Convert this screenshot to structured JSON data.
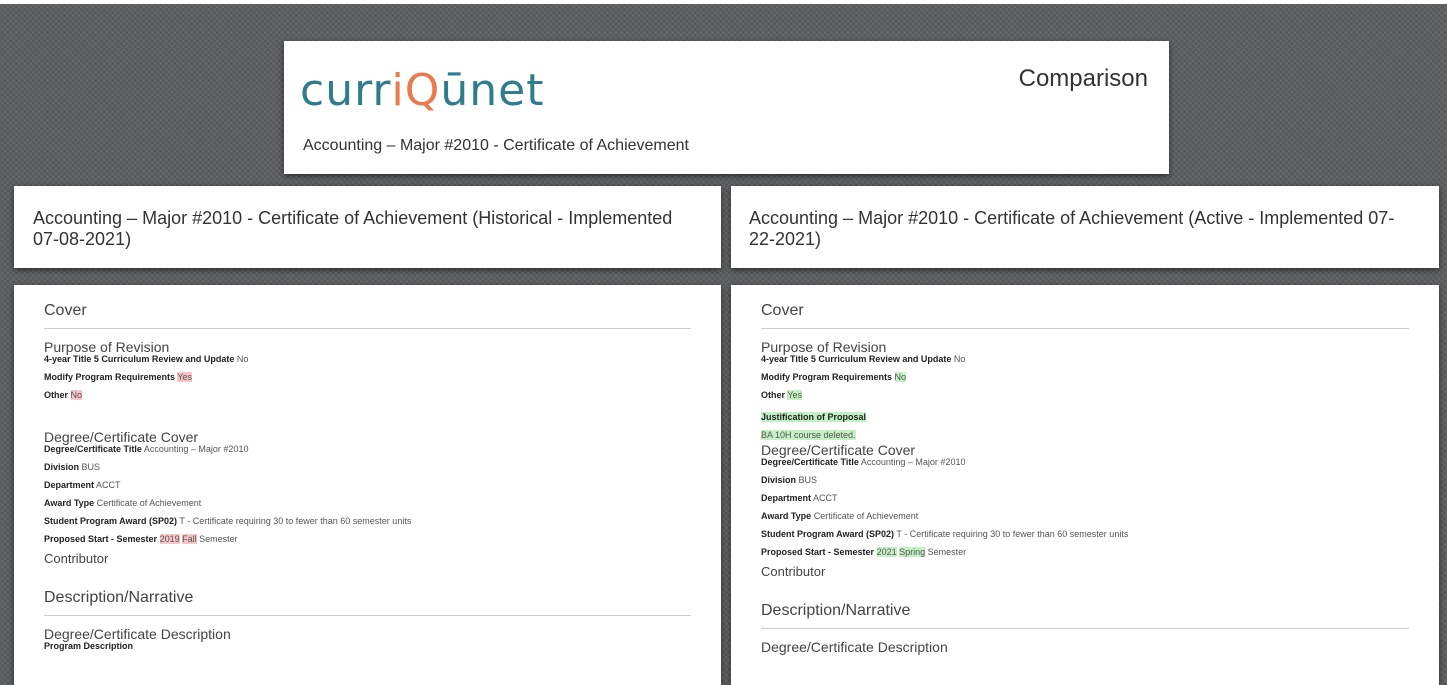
{
  "topbar": {},
  "header": {
    "logo_parts": [
      "curr",
      "iQ",
      "ūnet"
    ],
    "subtitle": "Accounting – Major #2010 - Certificate of Achievement",
    "right_title": "Comparison"
  },
  "colors": {
    "brand_teal": "#2f7d8c",
    "brand_orange": "#e87a4e",
    "removed": "#f6c6c6",
    "added": "#c4f1c4"
  },
  "left": {
    "title": "Accounting – Major #2010 - Certificate of Achievement (Historical - Implemented 07-08-2021)",
    "cover_heading": "Cover",
    "purpose_heading": "Purpose of Revision",
    "title5_label": "4-year Title 5 Curriculum Review and Update",
    "title5_value": "No",
    "modify_label": "Modify Program Requirements",
    "modify_value": "Yes",
    "other_label": "Other",
    "other_value": "No",
    "degree_cover_heading": "Degree/Certificate Cover",
    "degree_title_label": "Degree/Certificate Title",
    "degree_title_value": "Accounting – Major #2010",
    "division_label": "Division",
    "division_value": "BUS",
    "department_label": "Department",
    "department_value": "ACCT",
    "award_type_label": "Award Type",
    "award_type_value": "Certificate of Achievement",
    "sp02_label": "Student Program Award (SP02)",
    "sp02_value": "T - Certificate requiring 30 to fewer than 60 semester units",
    "start_label": "Proposed Start - Semester",
    "start_year": "2019",
    "start_term": "Fall",
    "start_suffix": "Semester",
    "contributor": "Contributor",
    "desc_heading": "Description/Narrative",
    "desc_sub": "Degree/Certificate Description",
    "program_desc_label": "Program Description"
  },
  "right": {
    "title": "Accounting – Major #2010 - Certificate of Achievement (Active - Implemented 07-22-2021)",
    "cover_heading": "Cover",
    "purpose_heading": "Purpose of Revision",
    "title5_label": "4-year Title 5 Curriculum Review and Update",
    "title5_value": "No",
    "modify_label": "Modify Program Requirements",
    "modify_value": "No",
    "other_label": "Other",
    "other_value": "Yes",
    "justification_label": "Justification of Proposal",
    "justification_value": "BA 10H course deleted.",
    "degree_cover_heading": "Degree/Certificate Cover",
    "degree_title_label": "Degree/Certificate Title",
    "degree_title_value": "Accounting – Major #2010",
    "division_label": "Division",
    "division_value": "BUS",
    "department_label": "Department",
    "department_value": "ACCT",
    "award_type_label": "Award Type",
    "award_type_value": "Certificate of Achievement",
    "sp02_label": "Student Program Award (SP02)",
    "sp02_value": "T - Certificate requiring 30 to fewer than 60 semester units",
    "start_label": "Proposed Start - Semester",
    "start_year": "2021",
    "start_term": "Spring",
    "start_suffix": "Semester",
    "contributor": "Contributor",
    "desc_heading": "Description/Narrative",
    "desc_sub": "Degree/Certificate Description"
  }
}
